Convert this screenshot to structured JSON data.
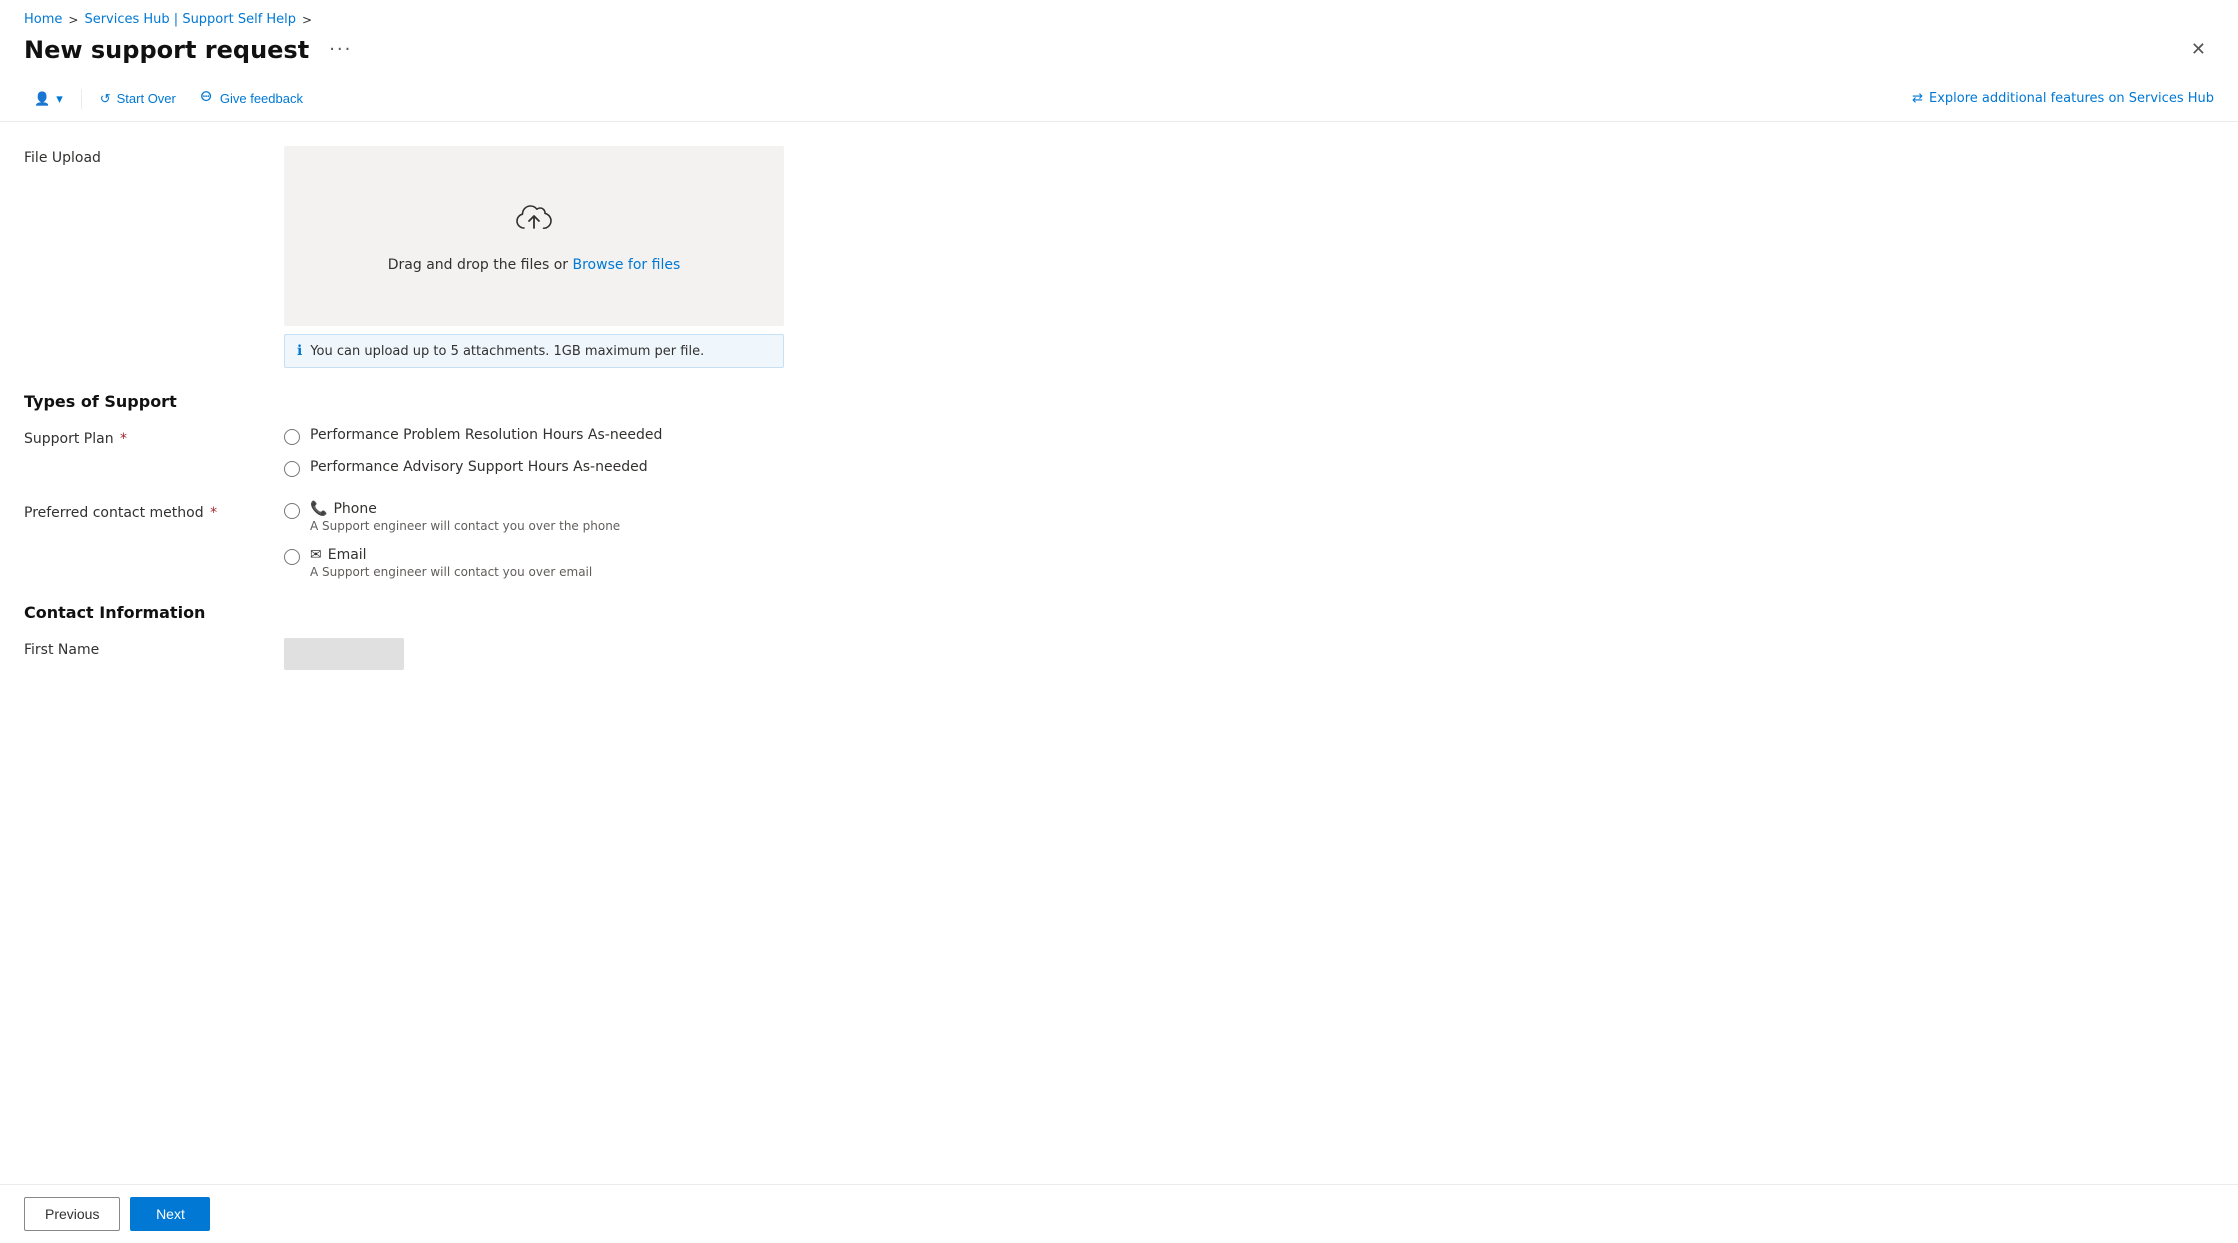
{
  "breadcrumb": {
    "home": "Home",
    "separator1": ">",
    "services": "Services Hub | Support Self Help",
    "separator2": ">"
  },
  "page": {
    "title": "New support request",
    "more_label": "···",
    "close_label": "✕"
  },
  "toolbar": {
    "user_icon": "👤",
    "dropdown_icon": "▾",
    "start_over_label": "Start Over",
    "start_over_icon": "↺",
    "give_feedback_label": "Give feedback",
    "give_feedback_icon": "🗣",
    "explore_label": "Explore additional features on Services Hub",
    "explore_icon": "⇄"
  },
  "file_upload": {
    "label": "File Upload",
    "drag_text": "Drag and drop the files or",
    "browse_link": "Browse for files",
    "info_text": "You can upload up to 5 attachments. 1GB maximum per file."
  },
  "types_of_support": {
    "heading": "Types of Support",
    "support_plan": {
      "label": "Support Plan",
      "required": true,
      "options": [
        {
          "id": "opt1",
          "value": "perf_resolution",
          "label": "Performance Problem Resolution Hours As-needed"
        },
        {
          "id": "opt2",
          "value": "perf_advisory",
          "label": "Performance Advisory Support Hours As-needed"
        }
      ]
    },
    "contact_method": {
      "label": "Preferred contact method",
      "required": true,
      "options": [
        {
          "id": "phone",
          "value": "phone",
          "icon": "📞",
          "label": "Phone",
          "sublabel": "A Support engineer will contact you over the phone"
        },
        {
          "id": "email",
          "value": "email",
          "icon": "✉",
          "label": "Email",
          "sublabel": "A Support engineer will contact you over email"
        }
      ]
    }
  },
  "contact_information": {
    "heading": "Contact Information",
    "first_name_label": "First Name"
  },
  "nav": {
    "previous_label": "Previous",
    "next_label": "Next"
  }
}
